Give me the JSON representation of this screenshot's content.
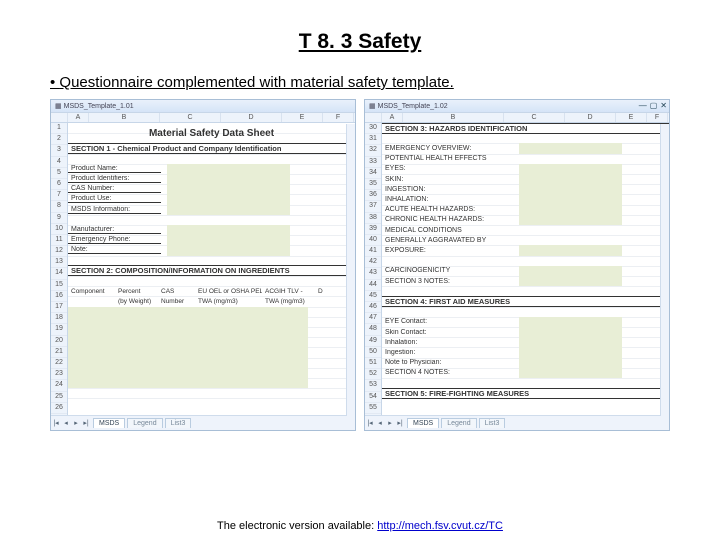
{
  "heading": "T 8. 3 Safety",
  "bullet": "Questionnaire complemented with material safety template.",
  "footer_prefix": "The electronic version available: ",
  "footer_link_text": "http://mech.fsv.cvut.cz/TC",
  "left": {
    "tab_title": "MSDS_Template_1.01",
    "cols": [
      "A",
      "B",
      "C",
      "D",
      "E",
      "F"
    ],
    "big_title": "Material Safety Data Sheet",
    "section1": "SECTION 1 - Chemical Product and Company Identification",
    "labels_s1": [
      "Product Name:",
      "Product Identifiers:",
      "CAS Number:",
      "Product Use:",
      "MSDS Information:",
      "Manufacturer:",
      "Emergency Phone:",
      "Note:"
    ],
    "section2": "SECTION 2: COMPOSITION/INFORMATION ON INGREDIENTS",
    "table_headers": [
      "Component",
      "Percent",
      "CAS",
      "EU OEL or OSHA PEL -",
      "ACGIH TLV -",
      "D"
    ],
    "table_sub": [
      "",
      "(by Weight)",
      "Number",
      "TWA (mg/m3)",
      "TWA (mg/m3)",
      ""
    ],
    "sheets": [
      "MSDS",
      "Legend",
      "List3"
    ],
    "row_start": 1,
    "row_count": 27
  },
  "right": {
    "tab_title": "MSDS_Template_1.02",
    "cols": [
      "A",
      "B",
      "C",
      "D",
      "E",
      "F"
    ],
    "section3": "SECTION 3: HAZARDS IDENTIFICATION",
    "s3_rows": [
      "EMERGENCY OVERVIEW:",
      "POTENTIAL HEALTH EFFECTS",
      "    EYES:",
      "    SKIN:",
      "    INGESTION:",
      "    INHALATION:",
      "ACUTE HEALTH HAZARDS:",
      "CHRONIC HEALTH HAZARDS:",
      "    MEDICAL CONDITIONS",
      "    GENERALLY AGGRAVATED BY",
      "    EXPOSURE:",
      "",
      "CARCINOGENICITY",
      "SECTION 3 NOTES:"
    ],
    "section4": "SECTION 4:  FIRST AID MEASURES",
    "s4_rows": [
      "EYE Contact:",
      "Skin Contact:",
      "Inhalation:",
      "Ingestion:",
      "Note to Physician:",
      "SECTION 4 NOTES:"
    ],
    "section5": "SECTION 5: FIRE-FIGHTING MEASURES",
    "sheets": [
      "MSDS",
      "Legend",
      "List3"
    ],
    "row_start": 30,
    "row_count": 27
  }
}
